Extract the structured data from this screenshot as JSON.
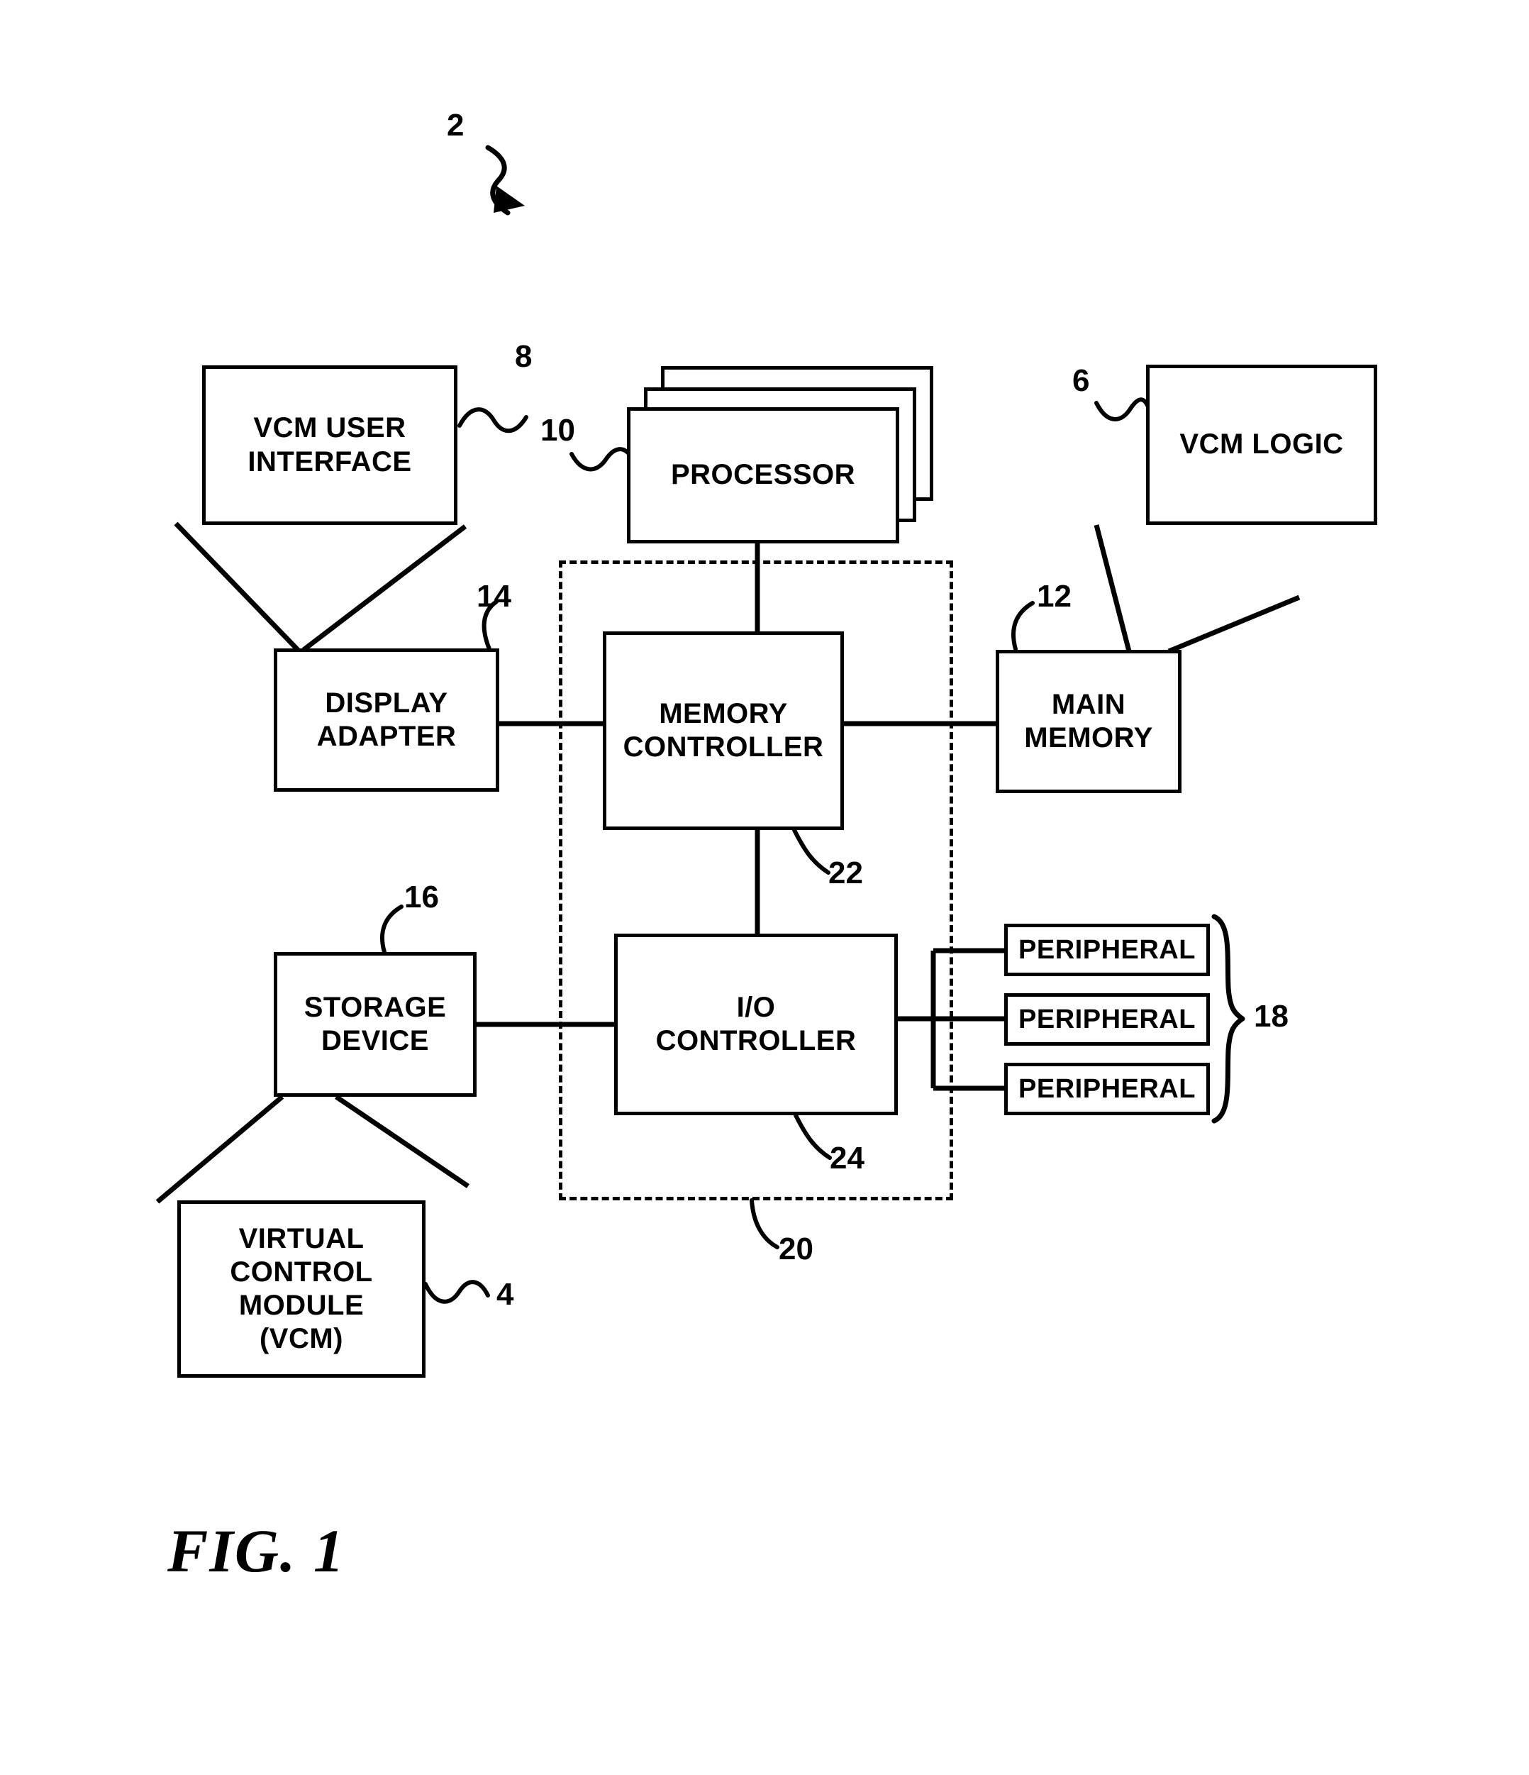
{
  "figure": {
    "caption": "FIG. 1",
    "system_ref": "2"
  },
  "nodes": {
    "vcm_user_interface": {
      "label": "VCM USER\nINTERFACE",
      "ref": "8"
    },
    "processor": {
      "label": "PROCESSOR",
      "ref": "10"
    },
    "vcm_logic": {
      "label": "VCM LOGIC",
      "ref": "6"
    },
    "display_adapter": {
      "label": "DISPLAY\nADAPTER",
      "ref": "14"
    },
    "memory_controller": {
      "label": "MEMORY\nCONTROLLER",
      "ref": "22"
    },
    "main_memory": {
      "label": "MAIN\nMEMORY",
      "ref": "12"
    },
    "storage_device": {
      "label": "STORAGE\nDEVICE",
      "ref": "16"
    },
    "io_controller": {
      "label": "I/O\nCONTROLLER",
      "ref": "24"
    },
    "virtual_control_module": {
      "label": "VIRTUAL\nCONTROL\nMODULE\n(VCM)",
      "ref": "4"
    },
    "chipset": {
      "ref": "20"
    }
  },
  "peripherals": {
    "group_ref": "18",
    "items": [
      {
        "label": "PERIPHERAL"
      },
      {
        "label": "PERIPHERAL"
      },
      {
        "label": "PERIPHERAL"
      }
    ]
  },
  "colors": {
    "ink": "#000000",
    "paper": "#ffffff"
  }
}
